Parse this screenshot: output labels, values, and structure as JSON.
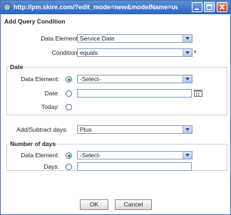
{
  "window": {
    "title": "http://pm.skire.com/?edit_mode=new&modelName=uwo&level=..."
  },
  "dialog": {
    "title": "Add Query Condition"
  },
  "data_element": {
    "label": "Data Element:",
    "value": "Service Date"
  },
  "condition": {
    "label": "Condition:",
    "value": "equals",
    "required_mark": "*"
  },
  "date_section": {
    "legend": "Date",
    "data_element_label": "Data Element:",
    "data_element_value": "-Select-",
    "date_label": "Date:",
    "today_label": "Today:"
  },
  "add_subtract": {
    "label": "Add/Subtract days:",
    "value": "Plus"
  },
  "days_section": {
    "legend": "Number of days",
    "data_element_label": "Data Element:",
    "data_element_value": "-Select-",
    "days_label": "Days:"
  },
  "buttons": {
    "ok": "OK",
    "cancel": "Cancel"
  }
}
